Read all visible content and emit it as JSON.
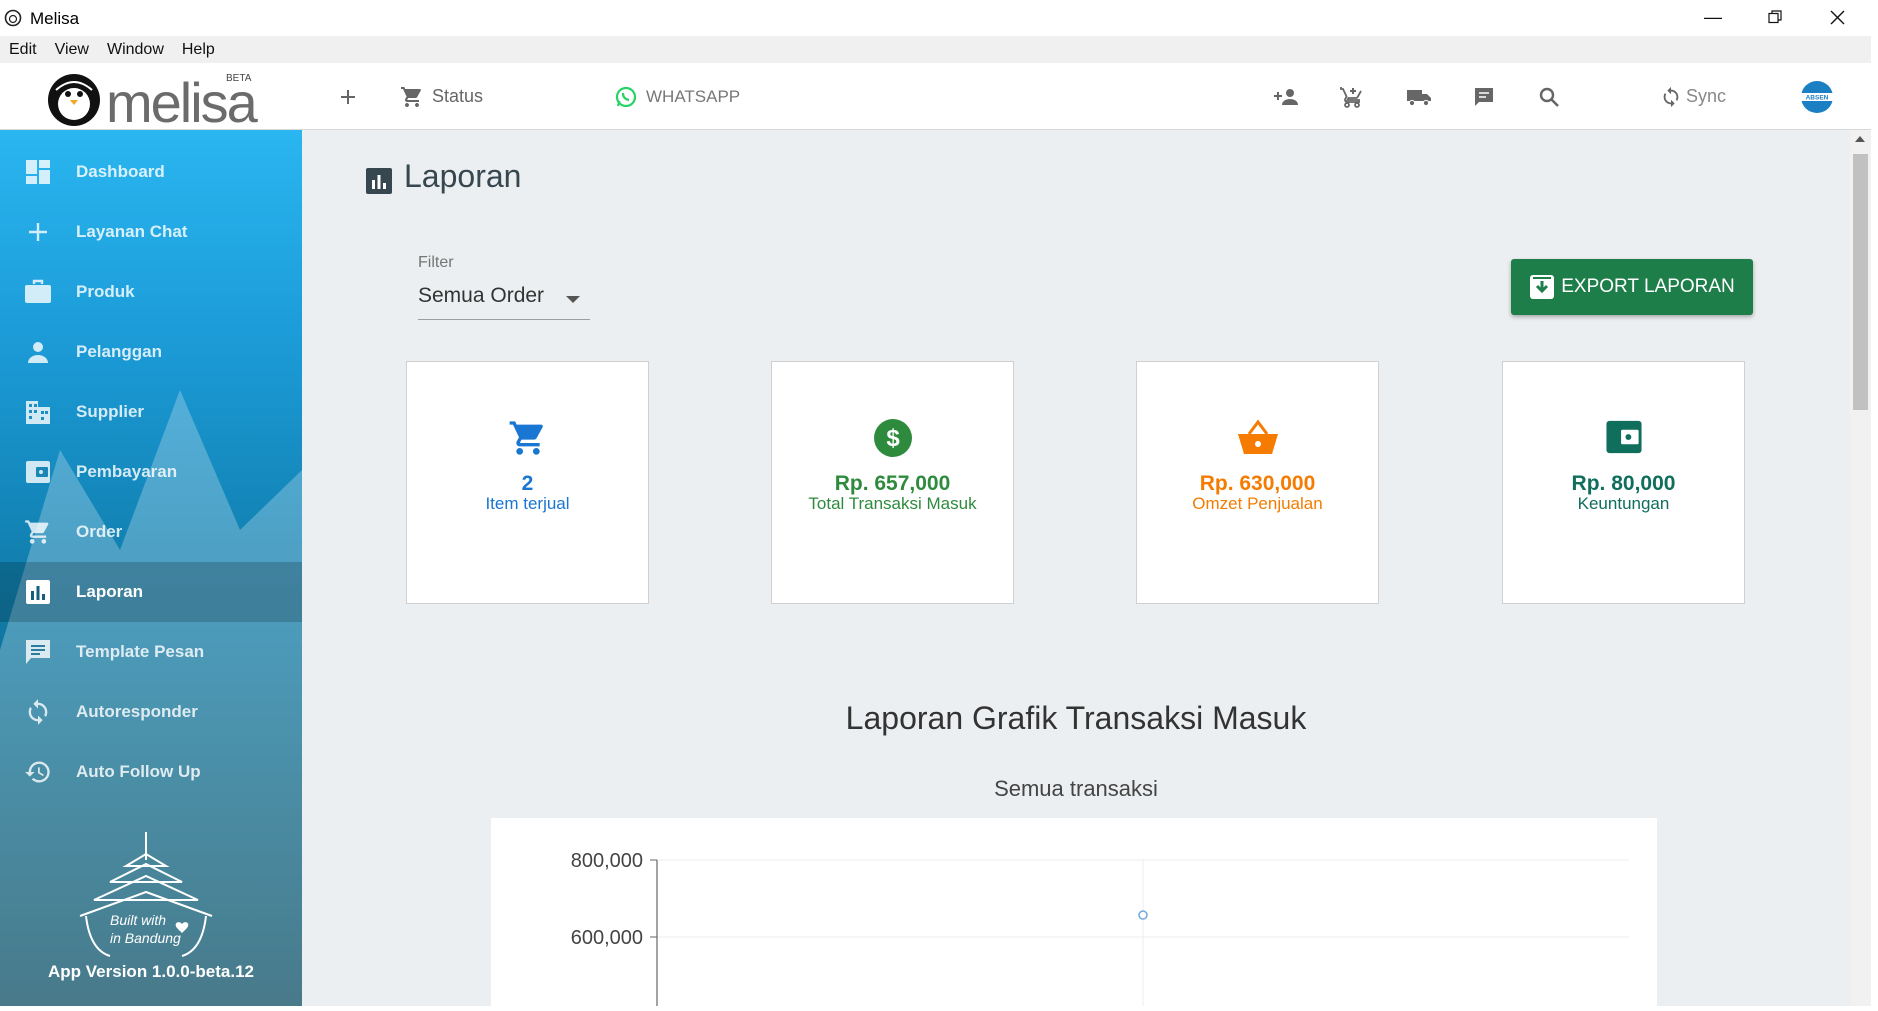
{
  "window": {
    "title": "Melisa"
  },
  "menu": [
    "Edit",
    "View",
    "Window",
    "Help"
  ],
  "header": {
    "logo_text": "melisa",
    "logo_badge": "BETA",
    "status_label": "Status",
    "whatsapp_label": "WHATSAPP",
    "sync_label": "Sync",
    "absen_label": "ABSEN"
  },
  "sidebar": {
    "items": [
      {
        "label": "Dashboard",
        "icon": "dashboard-icon"
      },
      {
        "label": "Layanan Chat",
        "icon": "plus-icon"
      },
      {
        "label": "Produk",
        "icon": "briefcase-icon"
      },
      {
        "label": "Pelanggan",
        "icon": "person-icon"
      },
      {
        "label": "Supplier",
        "icon": "building-icon"
      },
      {
        "label": "Pembayaran",
        "icon": "wallet-icon"
      },
      {
        "label": "Order",
        "icon": "cart-icon"
      },
      {
        "label": "Laporan",
        "icon": "report-icon"
      },
      {
        "label": "Template Pesan",
        "icon": "message-icon"
      },
      {
        "label": "Autoresponder",
        "icon": "sync-icon"
      },
      {
        "label": "Auto Follow Up",
        "icon": "history-icon"
      }
    ],
    "active": "Laporan",
    "built_line1": "Built with",
    "built_line2": "in Bandung",
    "version": "App Version 1.0.0-beta.12"
  },
  "page": {
    "title": "Laporan",
    "filter_label": "Filter",
    "filter_value": "Semua Order",
    "export_label": "EXPORT LAPORAN"
  },
  "cards": [
    {
      "value": "2",
      "caption": "Item terjual",
      "color": "#1976d2",
      "icon": "cart-icon"
    },
    {
      "value": "Rp. 657,000",
      "caption": "Total Transaksi Masuk",
      "color": "#2e8b3e",
      "icon": "dollar-icon"
    },
    {
      "value": "Rp. 630,000",
      "caption": "Omzet Penjualan",
      "color": "#f57c00",
      "icon": "basket-icon"
    },
    {
      "value": "Rp. 80,000",
      "caption": "Keuntungan",
      "color": "#0f6e5c",
      "icon": "wallet-icon"
    }
  ],
  "chart": {
    "title": "Laporan Grafik Transaksi Masuk",
    "subtitle": "Semua transaksi"
  },
  "chart_data": {
    "type": "line",
    "title": "Semua transaksi",
    "y_ticks": [
      "800,000",
      "600,000"
    ],
    "ylim": [
      600000,
      800000
    ],
    "series": [
      {
        "values": [
          657000
        ]
      }
    ],
    "grid": true
  }
}
